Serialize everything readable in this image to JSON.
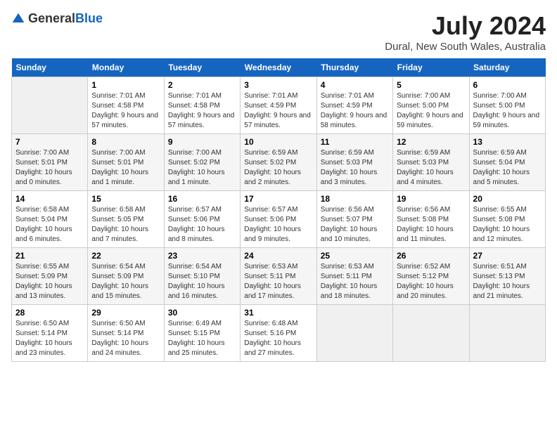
{
  "header": {
    "logo_general": "General",
    "logo_blue": "Blue",
    "month_year": "July 2024",
    "location": "Dural, New South Wales, Australia"
  },
  "days_of_week": [
    "Sunday",
    "Monday",
    "Tuesday",
    "Wednesday",
    "Thursday",
    "Friday",
    "Saturday"
  ],
  "weeks": [
    [
      {
        "day": "",
        "sunrise": "",
        "sunset": "",
        "daylight": "",
        "empty": true
      },
      {
        "day": "1",
        "sunrise": "Sunrise: 7:01 AM",
        "sunset": "Sunset: 4:58 PM",
        "daylight": "Daylight: 9 hours and 57 minutes."
      },
      {
        "day": "2",
        "sunrise": "Sunrise: 7:01 AM",
        "sunset": "Sunset: 4:58 PM",
        "daylight": "Daylight: 9 hours and 57 minutes."
      },
      {
        "day": "3",
        "sunrise": "Sunrise: 7:01 AM",
        "sunset": "Sunset: 4:59 PM",
        "daylight": "Daylight: 9 hours and 57 minutes."
      },
      {
        "day": "4",
        "sunrise": "Sunrise: 7:01 AM",
        "sunset": "Sunset: 4:59 PM",
        "daylight": "Daylight: 9 hours and 58 minutes."
      },
      {
        "day": "5",
        "sunrise": "Sunrise: 7:00 AM",
        "sunset": "Sunset: 5:00 PM",
        "daylight": "Daylight: 9 hours and 59 minutes."
      },
      {
        "day": "6",
        "sunrise": "Sunrise: 7:00 AM",
        "sunset": "Sunset: 5:00 PM",
        "daylight": "Daylight: 9 hours and 59 minutes."
      }
    ],
    [
      {
        "day": "7",
        "sunrise": "Sunrise: 7:00 AM",
        "sunset": "Sunset: 5:01 PM",
        "daylight": "Daylight: 10 hours and 0 minutes."
      },
      {
        "day": "8",
        "sunrise": "Sunrise: 7:00 AM",
        "sunset": "Sunset: 5:01 PM",
        "daylight": "Daylight: 10 hours and 1 minute."
      },
      {
        "day": "9",
        "sunrise": "Sunrise: 7:00 AM",
        "sunset": "Sunset: 5:02 PM",
        "daylight": "Daylight: 10 hours and 1 minute."
      },
      {
        "day": "10",
        "sunrise": "Sunrise: 6:59 AM",
        "sunset": "Sunset: 5:02 PM",
        "daylight": "Daylight: 10 hours and 2 minutes."
      },
      {
        "day": "11",
        "sunrise": "Sunrise: 6:59 AM",
        "sunset": "Sunset: 5:03 PM",
        "daylight": "Daylight: 10 hours and 3 minutes."
      },
      {
        "day": "12",
        "sunrise": "Sunrise: 6:59 AM",
        "sunset": "Sunset: 5:03 PM",
        "daylight": "Daylight: 10 hours and 4 minutes."
      },
      {
        "day": "13",
        "sunrise": "Sunrise: 6:59 AM",
        "sunset": "Sunset: 5:04 PM",
        "daylight": "Daylight: 10 hours and 5 minutes."
      }
    ],
    [
      {
        "day": "14",
        "sunrise": "Sunrise: 6:58 AM",
        "sunset": "Sunset: 5:04 PM",
        "daylight": "Daylight: 10 hours and 6 minutes."
      },
      {
        "day": "15",
        "sunrise": "Sunrise: 6:58 AM",
        "sunset": "Sunset: 5:05 PM",
        "daylight": "Daylight: 10 hours and 7 minutes."
      },
      {
        "day": "16",
        "sunrise": "Sunrise: 6:57 AM",
        "sunset": "Sunset: 5:06 PM",
        "daylight": "Daylight: 10 hours and 8 minutes."
      },
      {
        "day": "17",
        "sunrise": "Sunrise: 6:57 AM",
        "sunset": "Sunset: 5:06 PM",
        "daylight": "Daylight: 10 hours and 9 minutes."
      },
      {
        "day": "18",
        "sunrise": "Sunrise: 6:56 AM",
        "sunset": "Sunset: 5:07 PM",
        "daylight": "Daylight: 10 hours and 10 minutes."
      },
      {
        "day": "19",
        "sunrise": "Sunrise: 6:56 AM",
        "sunset": "Sunset: 5:08 PM",
        "daylight": "Daylight: 10 hours and 11 minutes."
      },
      {
        "day": "20",
        "sunrise": "Sunrise: 6:55 AM",
        "sunset": "Sunset: 5:08 PM",
        "daylight": "Daylight: 10 hours and 12 minutes."
      }
    ],
    [
      {
        "day": "21",
        "sunrise": "Sunrise: 6:55 AM",
        "sunset": "Sunset: 5:09 PM",
        "daylight": "Daylight: 10 hours and 13 minutes."
      },
      {
        "day": "22",
        "sunrise": "Sunrise: 6:54 AM",
        "sunset": "Sunset: 5:09 PM",
        "daylight": "Daylight: 10 hours and 15 minutes."
      },
      {
        "day": "23",
        "sunrise": "Sunrise: 6:54 AM",
        "sunset": "Sunset: 5:10 PM",
        "daylight": "Daylight: 10 hours and 16 minutes."
      },
      {
        "day": "24",
        "sunrise": "Sunrise: 6:53 AM",
        "sunset": "Sunset: 5:11 PM",
        "daylight": "Daylight: 10 hours and 17 minutes."
      },
      {
        "day": "25",
        "sunrise": "Sunrise: 6:53 AM",
        "sunset": "Sunset: 5:11 PM",
        "daylight": "Daylight: 10 hours and 18 minutes."
      },
      {
        "day": "26",
        "sunrise": "Sunrise: 6:52 AM",
        "sunset": "Sunset: 5:12 PM",
        "daylight": "Daylight: 10 hours and 20 minutes."
      },
      {
        "day": "27",
        "sunrise": "Sunrise: 6:51 AM",
        "sunset": "Sunset: 5:13 PM",
        "daylight": "Daylight: 10 hours and 21 minutes."
      }
    ],
    [
      {
        "day": "28",
        "sunrise": "Sunrise: 6:50 AM",
        "sunset": "Sunset: 5:14 PM",
        "daylight": "Daylight: 10 hours and 23 minutes."
      },
      {
        "day": "29",
        "sunrise": "Sunrise: 6:50 AM",
        "sunset": "Sunset: 5:14 PM",
        "daylight": "Daylight: 10 hours and 24 minutes."
      },
      {
        "day": "30",
        "sunrise": "Sunrise: 6:49 AM",
        "sunset": "Sunset: 5:15 PM",
        "daylight": "Daylight: 10 hours and 25 minutes."
      },
      {
        "day": "31",
        "sunrise": "Sunrise: 6:48 AM",
        "sunset": "Sunset: 5:16 PM",
        "daylight": "Daylight: 10 hours and 27 minutes."
      },
      {
        "day": "",
        "sunrise": "",
        "sunset": "",
        "daylight": "",
        "empty": true
      },
      {
        "day": "",
        "sunrise": "",
        "sunset": "",
        "daylight": "",
        "empty": true
      },
      {
        "day": "",
        "sunrise": "",
        "sunset": "",
        "daylight": "",
        "empty": true
      }
    ]
  ]
}
